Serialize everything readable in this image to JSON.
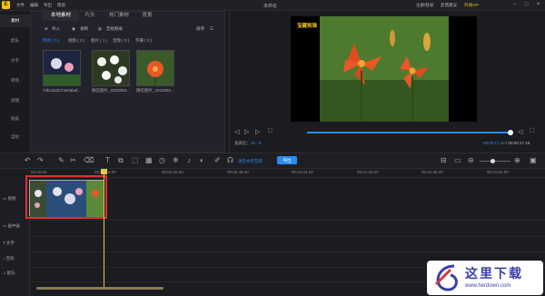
{
  "app": {
    "logo_glyph": "E",
    "menu": [
      "文件",
      "编辑",
      "导出",
      "帮助"
    ],
    "project_name": "未命名",
    "right_items": [
      "注册/登录",
      "反馈建议",
      "开通VIP"
    ],
    "vip_color": "#f0b429",
    "window_buttons": [
      "−",
      "□",
      "×"
    ]
  },
  "rail": {
    "items": [
      "素材",
      "配乐",
      "文字",
      "转场",
      "滤镜",
      "贴纸",
      "自绘"
    ],
    "active_index": 0
  },
  "media": {
    "tabs": [
      "本地素材",
      "片头",
      "热门素材",
      "背景"
    ],
    "active_tab": 0,
    "import_label": "导入",
    "record_label": "录制",
    "mic_label": "音视频录",
    "sort_label": "排序",
    "filters": [
      "所有 ( 3 )",
      "视频 ( 2 )",
      "图片 ( 1 )",
      "音频 ( 0 )",
      "字幕 ( 0 )"
    ],
    "active_filter": 0,
    "files": [
      "73bc3a2b73e0abaf...",
      "微信图片_2022050...",
      "微信图片_2022050..."
    ]
  },
  "preview": {
    "watermark": "宝藏剪辑",
    "ratio_label": "宽高比：",
    "ratio_value": "16 : 9",
    "current_time": "00:00:17.18",
    "total_time": "00:00:17.18",
    "time_sep": " / ",
    "progress": 1.0,
    "accent": "#2d8cf0"
  },
  "toolbar": {
    "subtitle_label": "语音文字互转",
    "export_label": "导出"
  },
  "ruler": {
    "ticks": [
      "00:00:00",
      "00:00:16.00",
      "00:00:32.00",
      "00:00:48.00",
      "00:01:04.00",
      "00:01:20.00",
      "00:01:36.00",
      "00:01:52.00"
    ]
  },
  "tracks": {
    "labels": [
      "视频",
      "画中画",
      "文字",
      "音效",
      "配乐"
    ]
  },
  "site_watermark": {
    "cn": "这里下载",
    "url": "www.herdown.com"
  }
}
